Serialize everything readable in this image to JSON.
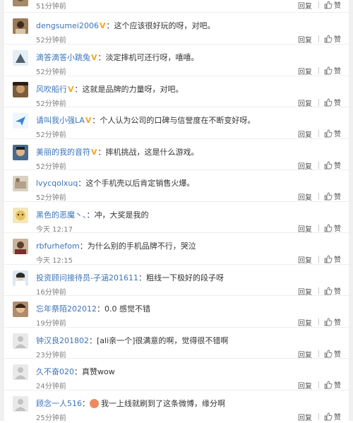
{
  "comments": [
    {
      "user": "",
      "verified": false,
      "text": "",
      "time": "51分钟前",
      "reply": "回复",
      "like": "赞"
    },
    {
      "user": "dengsumei2006",
      "verified": true,
      "text": "这个应该很好玩的呀，对吧。",
      "time": "52分钟前",
      "reply": "回复",
      "like": "赞"
    },
    {
      "user": "滴答滴答小跳兔",
      "verified": true,
      "text": "淡定摔机可还行呀，嘻嘻。",
      "time": "52分钟前",
      "reply": "回复",
      "like": "赞"
    },
    {
      "user": "风吹船行",
      "verified": true,
      "text": "这就是品牌的力量呀，对吧。",
      "time": "52分钟前",
      "reply": "回复",
      "like": "赞"
    },
    {
      "user": "请叫我小强LA",
      "verified": true,
      "text": "个人认为公司的口碑与信誉度在不断变好呀。",
      "time": "52分钟前",
      "reply": "回复",
      "like": "赞"
    },
    {
      "user": "美丽的我的音符",
      "verified": true,
      "text": "摔机挑战，这是什么游戏。",
      "time": "52分钟前",
      "reply": "回复",
      "like": "赞"
    },
    {
      "user": "lvycqolxuq",
      "verified": false,
      "text": "这个手机壳以后肯定销售火爆。",
      "time": "52分钟前",
      "reply": "回复",
      "like": "赞"
    },
    {
      "user": "黑色的恶魔丶、",
      "verified": false,
      "text": "冲，大奖是我的",
      "time": "今天 12:17",
      "reply": "回复",
      "like": "赞"
    },
    {
      "user": "rbfurhefom",
      "verified": false,
      "text": "为什么别的手机品牌不行，哭泣",
      "time": "今天 12:15",
      "reply": "回复",
      "like": "赞"
    },
    {
      "user": "投资顾问接待员-子涵201611",
      "verified": false,
      "text": "粗线一下极好的段子呀",
      "time": "16分钟前",
      "reply": "回复",
      "like": "赞"
    },
    {
      "user": "忘年祭陌202012",
      "verified": false,
      "text": "0.0 感觉不错",
      "time": "19分钟前",
      "reply": "回复",
      "like": "赞"
    },
    {
      "user": "钟汉良201802",
      "verified": false,
      "text": "[ali亲一个]很满意的啊，觉得很不错啊",
      "time": "23分钟前",
      "reply": "回复",
      "like": "赞"
    },
    {
      "user": "久不奋020",
      "verified": false,
      "text": "真赞wow",
      "time": "24分钟前",
      "reply": "回复",
      "like": "赞"
    },
    {
      "user": "顾念一人516",
      "verified": false,
      "text": "我一上线就刷到了这条微博，缘分啊",
      "time": "25分钟前",
      "reply": "回复",
      "like": "赞"
    }
  ],
  "colors": {
    "link": "#3b73b9",
    "verified": "#f5a623",
    "muted": "#808080"
  }
}
